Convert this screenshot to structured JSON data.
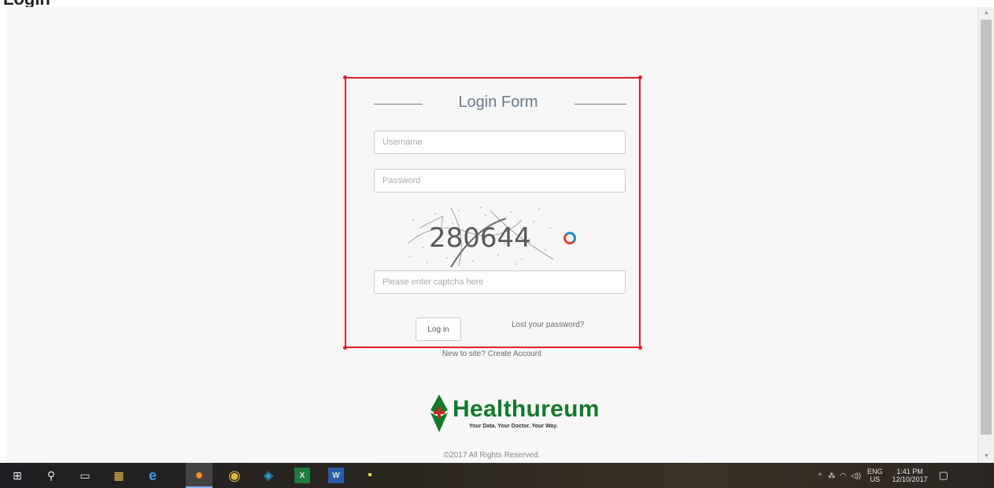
{
  "page": {
    "cut_title": "Login"
  },
  "form": {
    "title": "Login Form",
    "username_placeholder": "Username",
    "password_placeholder": "Password",
    "captcha_text": "280644",
    "captcha_placeholder": "Please enter captcha here",
    "login_label": "Log in",
    "lost_password_label": "Lost your password?"
  },
  "signup_text": "New to site? Create Account",
  "brand": {
    "name": "Healthureum",
    "tagline": "Your Data. Your Doctor. Your Way.",
    "colors": {
      "green": "#137a2a",
      "red": "#c62828"
    }
  },
  "copyright": "©2017 All Rights Reserved.",
  "taskbar": {
    "apps": [
      {
        "name": "start-icon",
        "glyph": "⊞"
      },
      {
        "name": "search-icon",
        "glyph": "⚲"
      },
      {
        "name": "task-view-icon",
        "glyph": "▭"
      },
      {
        "name": "file-explorer-icon",
        "glyph": "▦"
      },
      {
        "name": "edge-icon",
        "glyph": "e"
      },
      {
        "name": "firefox-icon",
        "glyph": "●"
      },
      {
        "name": "chrome-icon",
        "glyph": "◉"
      },
      {
        "name": "telegram-icon",
        "glyph": "◈"
      },
      {
        "name": "excel-icon",
        "glyph": "X"
      },
      {
        "name": "word-icon",
        "glyph": "W"
      },
      {
        "name": "sticky-notes-icon",
        "glyph": "▪"
      }
    ],
    "tray": {
      "language": "ENG",
      "region": "US",
      "time": "1:41 PM",
      "date": "12/10/2017"
    }
  },
  "colors": {
    "highlight_border": "#e31f2a",
    "page_bg": "#f7f7f7"
  }
}
